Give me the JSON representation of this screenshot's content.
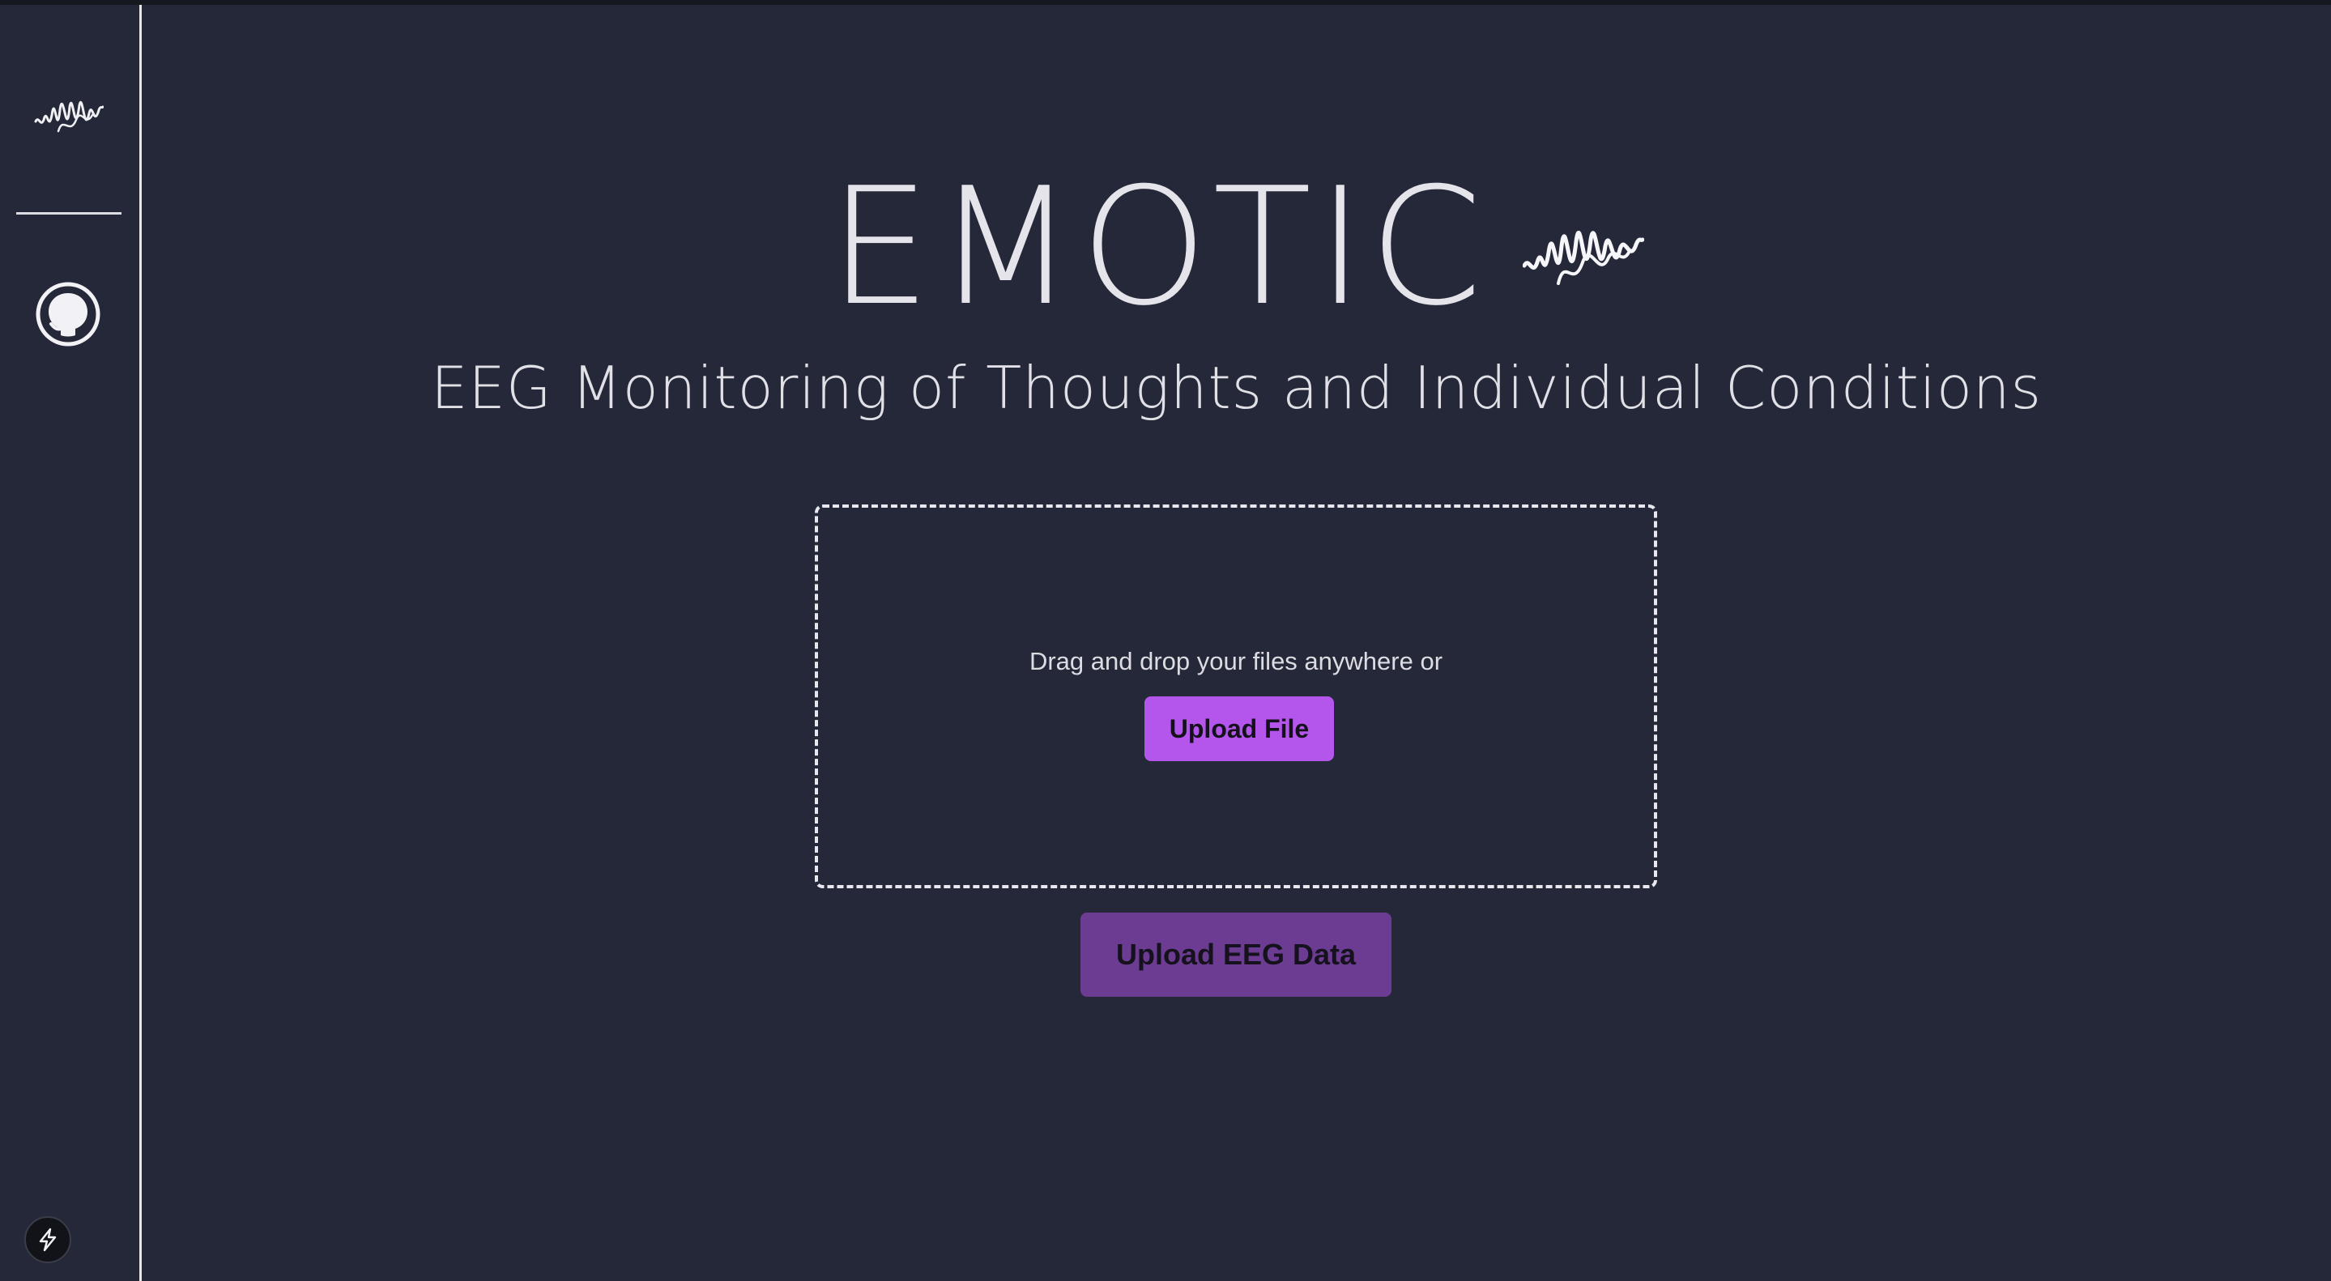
{
  "app": {
    "title": "EMOTIC",
    "subtitle": "EEG Monitoring of Thoughts and Individual Conditions"
  },
  "sidebar": {
    "logo_icon": "eeg-wave-icon",
    "github_icon": "github-icon",
    "bolt_icon": "lightning-bolt-icon"
  },
  "upload": {
    "drop_text": "Drag and drop your files anywhere or",
    "upload_file_label": "Upload File",
    "submit_label": "Upload EEG Data"
  },
  "colors": {
    "background": "#242838",
    "accent": "#b455ec",
    "accent_dim": "#6b3c91",
    "text": "#e4e4ea"
  }
}
